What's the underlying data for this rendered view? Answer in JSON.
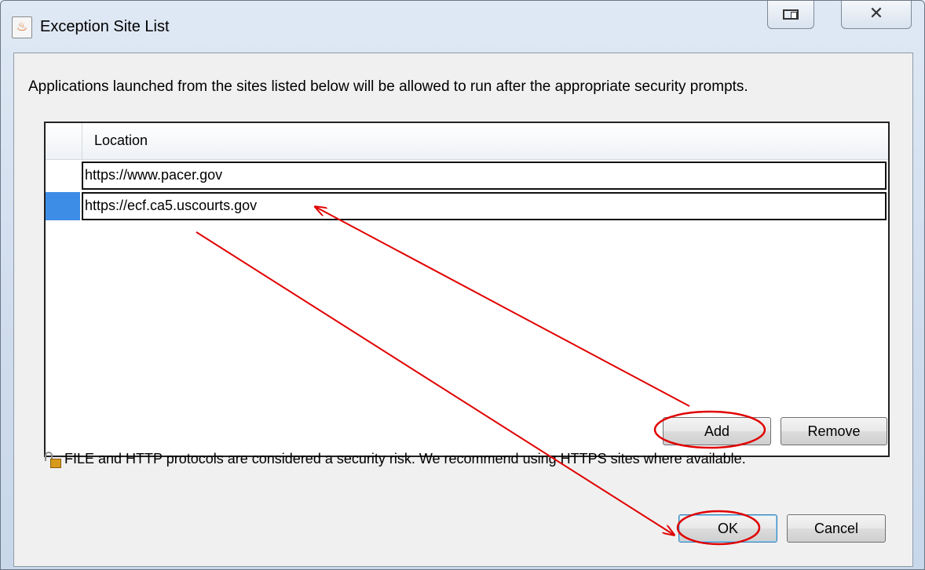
{
  "window": {
    "title": "Exception Site List",
    "icon": "java-icon"
  },
  "dialog": {
    "description": "Applications launched from the sites listed below will be allowed to run after the appropriate security prompts.",
    "table": {
      "column_header": "Location",
      "rows": [
        {
          "location": "https://www.pacer.gov",
          "selected": false
        },
        {
          "location": "https://ecf.ca5.uscourts.gov",
          "selected": true
        }
      ]
    },
    "buttons": {
      "add": "Add",
      "remove": "Remove",
      "ok": "OK",
      "cancel": "Cancel"
    },
    "warning": "FILE and HTTP protocols are considered a security risk.  We recommend using HTTPS sites where available."
  },
  "annotations": {
    "color": "#e00000"
  },
  "colors": {
    "selection": "#3d8de6",
    "window_frame": "#cfdced"
  }
}
